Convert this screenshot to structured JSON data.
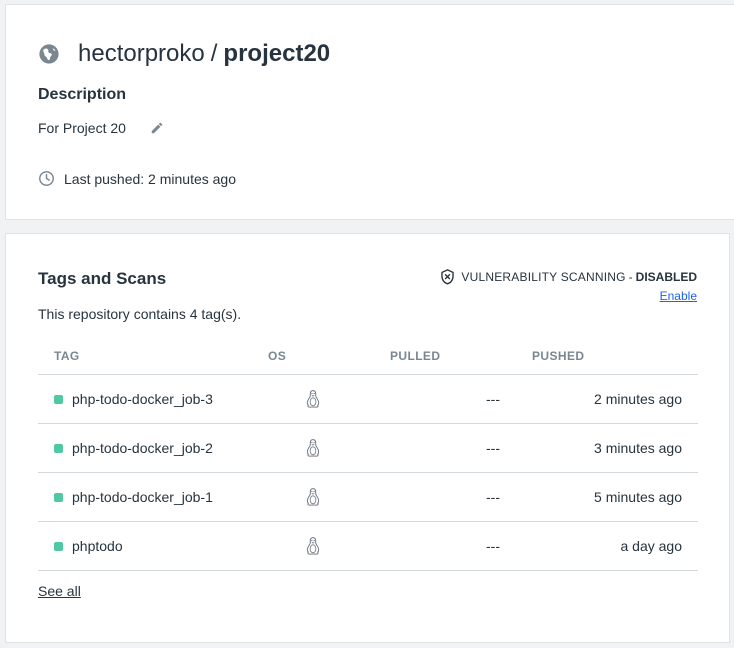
{
  "repo": {
    "owner": "hectorproko",
    "separator": "/",
    "name": "project20",
    "description_label": "Description",
    "description": "For Project 20",
    "last_pushed": "Last pushed: 2 minutes ago"
  },
  "tags_section": {
    "title": "Tags and Scans",
    "summary": "This repository contains 4 tag(s).",
    "vulnerability": {
      "label": "VULNERABILITY SCANNING",
      "dash": "-",
      "status": "DISABLED",
      "enable_link": "Enable"
    },
    "columns": {
      "tag": "TAG",
      "os": "OS",
      "pulled": "PULLED",
      "pushed": "PUSHED"
    },
    "rows": [
      {
        "tag": "php-todo-docker_job-3",
        "os": "linux-icon",
        "pulled": "---",
        "pushed": "2 minutes ago"
      },
      {
        "tag": "php-todo-docker_job-2",
        "os": "linux-icon",
        "pulled": "---",
        "pushed": "3 minutes ago"
      },
      {
        "tag": "php-todo-docker_job-1",
        "os": "linux-icon",
        "pulled": "---",
        "pushed": "5 minutes ago"
      },
      {
        "tag": "phptodo",
        "os": "linux-icon",
        "pulled": "---",
        "pushed": "a day ago"
      }
    ],
    "see_all": "See all"
  },
  "colors": {
    "text": "#27343f",
    "muted": "#7a8790",
    "link": "#1d63ed",
    "tag_dot": "#4ec9a4",
    "background": "#f1f2f3"
  }
}
